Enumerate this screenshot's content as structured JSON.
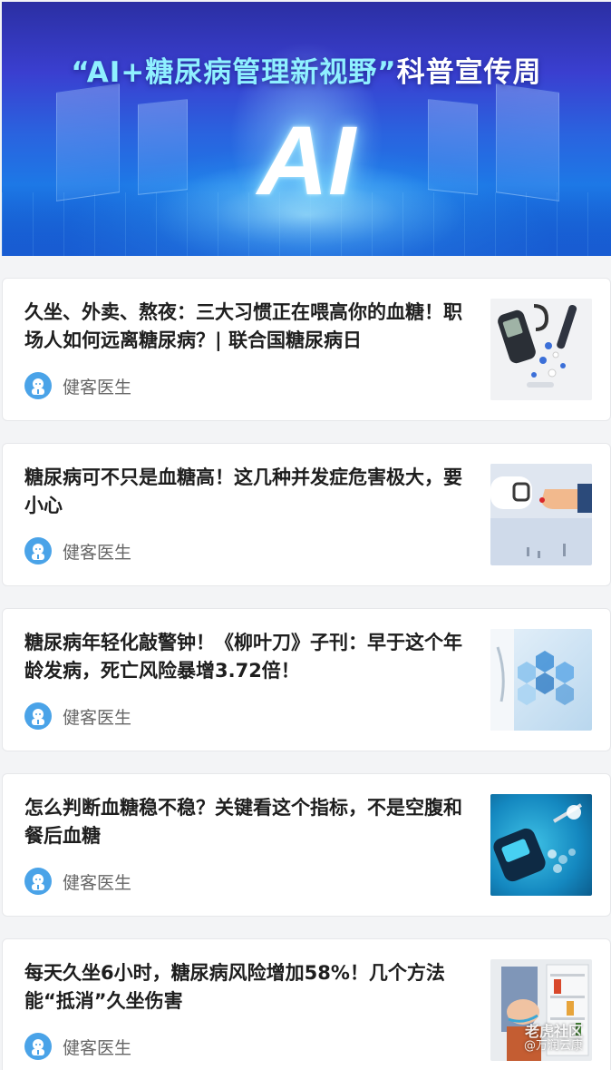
{
  "banner": {
    "title_highlight": "“AI+糖尿病管理新视野”",
    "title_rest": "科普宣传周",
    "big_text": "AI"
  },
  "articles": [
    {
      "title": "久坐、外卖、熬夜：三大习惯正在喂高你的血糖！职场人如何远离糖尿病？| 联合国糖尿病日",
      "author": "健客医生",
      "thumb_icon": "glucose-meter-icon"
    },
    {
      "title": "糖尿病可不只是血糖高！这几种并发症危害极大，要小心",
      "author": "健客医生",
      "thumb_icon": "finger-blood-test-icon"
    },
    {
      "title": "糖尿病年轻化敲警钟！《柳叶刀》子刊：早于这个年龄发病，死亡风险暴增3.72倍！",
      "author": "健客医生",
      "thumb_icon": "medical-hexagon-icon"
    },
    {
      "title": "怎么判断血糖稳不稳？关键看这个指标，不是空腹和餐后血糖",
      "author": "健客医生",
      "thumb_icon": "glucose-device-icon"
    },
    {
      "title": "每天久坐6小时，糖尿病风险增加58%！几个方法能“抵消”久坐伤害",
      "author": "健客医生",
      "thumb_icon": "sitting-person-icon"
    }
  ],
  "watermark": {
    "main": "老虎社区",
    "sub": "@万润云康"
  },
  "colors": {
    "card_bg": "#ffffff",
    "page_bg": "#f3f4f6",
    "title_text": "#1e1e1e",
    "author_text": "#666666",
    "avatar": "#4aa3e8"
  }
}
